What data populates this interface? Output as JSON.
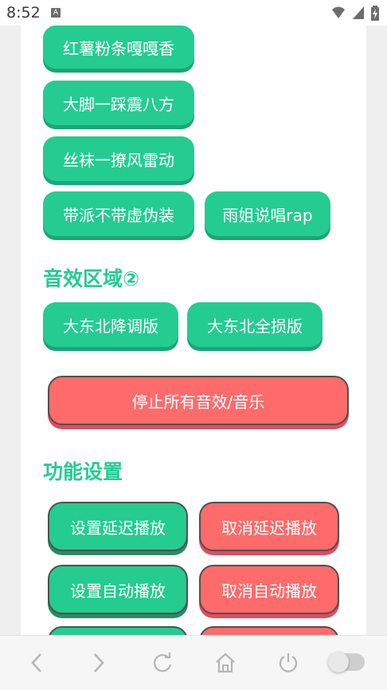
{
  "status_bar": {
    "time": "8:52",
    "app_icon_letter": "A"
  },
  "buttons_top": [
    {
      "label": "红薯粉条嘎嘎香"
    },
    {
      "label": "大脚一踩震八方"
    },
    {
      "label": "丝袜一撩风雷动"
    },
    {
      "label": "带派不带虚伪装"
    },
    {
      "label": "雨姐说唱rap"
    }
  ],
  "section2": {
    "title": "音效区域②",
    "buttons": [
      {
        "label": "大东北降调版"
      },
      {
        "label": "大东北全损版"
      }
    ]
  },
  "stop_button": {
    "label": "停止所有音效/音乐"
  },
  "settings": {
    "title": "功能设置",
    "set_delay_label": "设置延迟播放",
    "cancel_delay_label": "取消延迟播放",
    "set_auto_label": "设置自动播放",
    "cancel_auto_label": "取消自动播放"
  },
  "colors": {
    "accent": "#24cc91",
    "danger": "#fd6b6b"
  },
  "nav_bar": {
    "icons": [
      "back-icon",
      "forward-icon",
      "reload-icon",
      "home-icon",
      "power-icon",
      "toggle-switch"
    ]
  }
}
